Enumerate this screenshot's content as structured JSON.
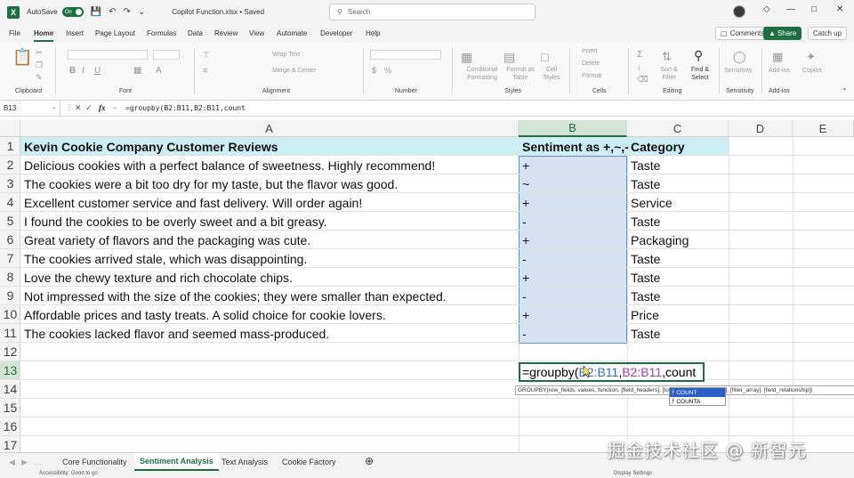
{
  "titlebar": {
    "app_logo": "X",
    "autosave_label": "AutoSave",
    "autosave_state": "On",
    "file_title": "Copilot Function.xlsx • Saved",
    "search_placeholder": "Search"
  },
  "ribbon_tabs": [
    "File",
    "Home",
    "Insert",
    "Page Layout",
    "Formulas",
    "Data",
    "Review",
    "View",
    "Automate",
    "Developer",
    "Help"
  ],
  "active_tab": "Home",
  "ribbon_buttons": {
    "comments": "Comments",
    "share": "Share",
    "catchup": "Catch up"
  },
  "ribbon_groups": {
    "clipboard": "Clipboard",
    "font": "Font",
    "alignment": "Alignment",
    "number": "Number",
    "styles": "Styles",
    "cells": "Cells",
    "editing": "Editing",
    "sensitivity": "Sensitivity",
    "addins": "Add-ins"
  },
  "ribbon_items": {
    "wrap_text": "Wrap Text",
    "merge_center": "Merge & Center",
    "conditional_formatting": "Conditional Formatting",
    "format_as_table": "Format as Table",
    "cell_styles": "Cell Styles",
    "insert": "Insert",
    "delete": "Delete",
    "format": "Format",
    "sort_filter": "Sort & Filter",
    "find_select": "Find & Select",
    "sensitivity": "Sensitivity",
    "addins": "Add-ins",
    "copilot": "Copilot"
  },
  "formula_bar": {
    "name_box": "B13",
    "fx": "fx",
    "formula": "=groupby(B2:B11,B2:B11,count"
  },
  "columns": [
    "A",
    "B",
    "C",
    "D",
    "E"
  ],
  "selected_column": "B",
  "row_numbers": [
    "1",
    "2",
    "3",
    "4",
    "5",
    "6",
    "7",
    "8",
    "9",
    "10",
    "11",
    "12",
    "13",
    "14",
    "15",
    "16",
    "17"
  ],
  "header_row": {
    "a": "Kevin Cookie Company Customer Reviews",
    "b": "Sentiment as +,~,-",
    "c": "Category"
  },
  "rows": [
    {
      "a": "Delicious cookies with a perfect balance of sweetness. Highly recommend!",
      "b": "+",
      "c": "Taste"
    },
    {
      "a": "The cookies were a bit too dry for my taste, but the flavor was good.",
      "b": "~",
      "c": "Taste"
    },
    {
      "a": "Excellent customer service and fast delivery. Will order again!",
      "b": "+",
      "c": "Service"
    },
    {
      "a": "I found the cookies to be overly sweet and a bit greasy.",
      "b": "-",
      "c": "Taste"
    },
    {
      "a": "Great variety of flavors and the packaging was cute.",
      "b": "+",
      "c": "Packaging"
    },
    {
      "a": "The cookies arrived stale, which was disappointing.",
      "b": "-",
      "c": "Taste"
    },
    {
      "a": "Love the chewy texture and rich chocolate chips.",
      "b": "+",
      "c": "Taste"
    },
    {
      "a": "Not impressed with the size of the cookies; they were smaller than expected.",
      "b": "-",
      "c": "Taste"
    },
    {
      "a": "Affordable prices and tasty treats. A solid choice for cookie lovers.",
      "b": "+",
      "c": "Price"
    },
    {
      "a": "The cookies lacked flavor and seemed mass-produced.",
      "b": "-",
      "c": "Taste"
    }
  ],
  "edit_cell": {
    "prefix": "=groupby(",
    "ref1": "B2:B11",
    "sep": ",",
    "ref2": "B2:B11",
    "suffix": ",count"
  },
  "tooltip": "GROUPBY(row_fields, values, function, [field_headers], [total_depth], [sort_order], [filter_array], [field_relationship])",
  "autocomplete": [
    "COUNT",
    "COUNTA"
  ],
  "sheet_tabs": [
    "Core Functionality",
    "Sentiment Analysis",
    "Text Analysis",
    "Cookie Factory"
  ],
  "active_sheet": "Sentiment Analysis",
  "status": {
    "accessibility": "Accessibility: Good to go",
    "display": "Display Settings"
  },
  "watermark": "掘金技术社区 @ 新智元",
  "colors": {
    "excel_green": "#1d6f42",
    "header_fill": "#cdeef4",
    "selection": "#5b8fd6"
  }
}
